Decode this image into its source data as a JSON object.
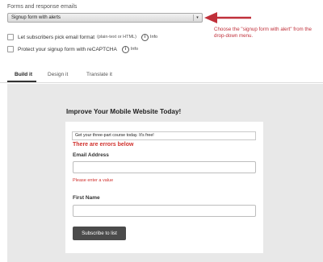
{
  "forms": {
    "section_label": "Forms and response emails",
    "select_value": "Signup form with alerts",
    "options": [
      {
        "label": "Let subscribers pick email format",
        "sub": "(plain-text or HTML)",
        "info": "Info"
      },
      {
        "label": "Protect your signup form with reCAPTCHA",
        "sub": "",
        "info": "Info"
      }
    ]
  },
  "annotation": "Choose the \"signup form with alert\" from the drop-down menu.",
  "tabs": [
    {
      "label": "Build it"
    },
    {
      "label": "Design it"
    },
    {
      "label": "Translate it"
    }
  ],
  "form_preview": {
    "headline": "Improve Your Mobile Website Today!",
    "promo": "Get your three-part course today. It's free!",
    "error_banner": "There are errors below",
    "email_label": "Email Address",
    "email_error": "Please enter a value",
    "first_name_label": "First Name",
    "submit_label": "Subscribe to list"
  },
  "colors": {
    "accent_red": "#c0303a",
    "error_red": "#d0312d",
    "button_dark": "#4b4b4b",
    "canvas_gray": "#e8e8e8"
  },
  "icons": {
    "info": "info-circle-icon",
    "select_caret": "chevron-down-icon",
    "annotation_arrow": "left-arrow-icon"
  }
}
